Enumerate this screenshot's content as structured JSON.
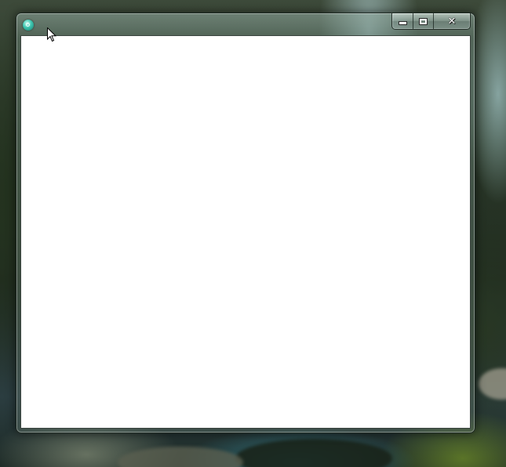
{
  "window": {
    "title": "",
    "icon": "app-disc-icon",
    "controls": {
      "minimize_icon": "minimize-icon",
      "maximize_icon": "maximize-icon",
      "close_icon": "close-icon",
      "close_glyph": "✕"
    }
  },
  "client_area": {
    "background": "#ffffff"
  },
  "colors": {
    "client_background": "#ffffff",
    "frame_tint": "#7f9b8f"
  }
}
